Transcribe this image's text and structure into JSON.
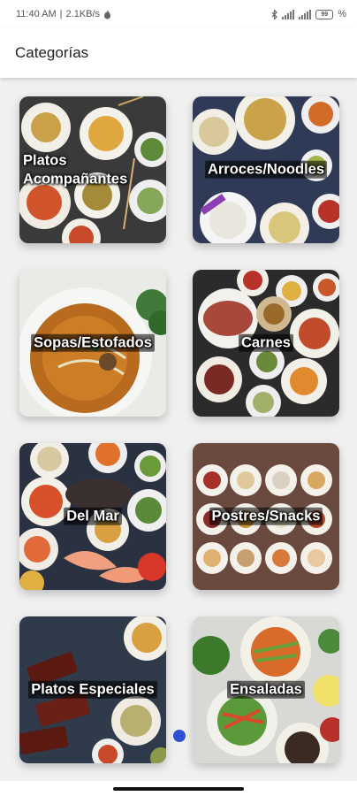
{
  "status": {
    "time": "11:40 AM",
    "separator": "|",
    "speed": "2.1KB/s",
    "battery_level": "99",
    "battery_pct_label": "%"
  },
  "appbar": {
    "title": "Categorías"
  },
  "categories": [
    {
      "label_line1": "Platos",
      "label_line2": "Acompañantes",
      "theme": "side-dishes"
    },
    {
      "label": "Arroces/Noodles",
      "theme": "rice-noodles"
    },
    {
      "label": "Sopas/Estofados",
      "theme": "soups"
    },
    {
      "label": "Carnes",
      "theme": "meats"
    },
    {
      "label": "Del Mar",
      "theme": "seafood"
    },
    {
      "label": "Postres/Snacks",
      "theme": "desserts"
    },
    {
      "label": "Platos Especiales",
      "theme": "specials"
    },
    {
      "label": "Ensaladas",
      "theme": "salads"
    }
  ],
  "colors": {
    "accent_dot": "#2f4fd6",
    "appbar_bg": "#ffffff",
    "page_bg": "#f0f0f0"
  }
}
